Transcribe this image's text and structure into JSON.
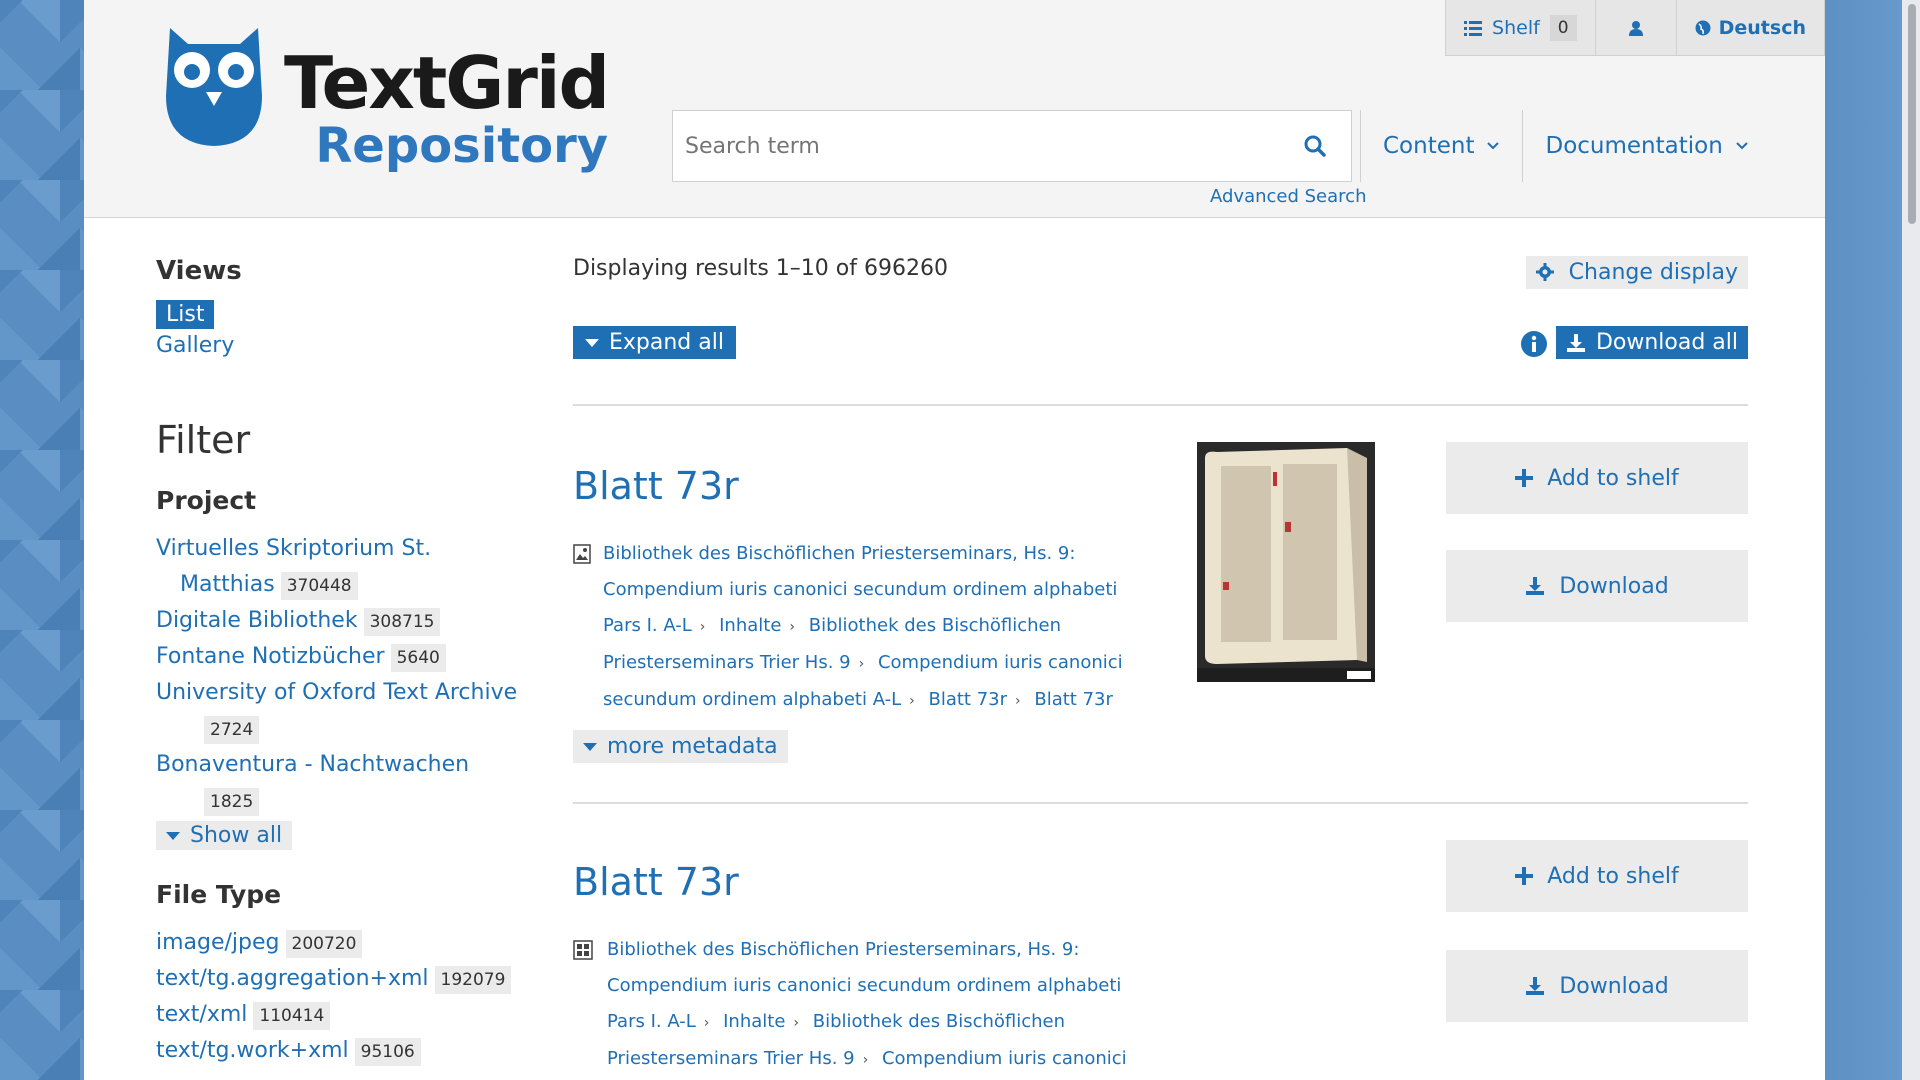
{
  "header": {
    "logo_title": "TextGrid",
    "logo_sub": "Repository",
    "shelf_label": "Shelf",
    "shelf_count": "0",
    "language": "Deutsch",
    "search_placeholder": "Search term",
    "advanced_search": "Advanced Search",
    "nav": [
      {
        "label": "Content"
      },
      {
        "label": "Documentation"
      }
    ]
  },
  "sidebar": {
    "views_title": "Views",
    "views": [
      "List",
      "Gallery"
    ],
    "filter_title": "Filter",
    "project_title": "Project",
    "projects": [
      {
        "label": "Virtuelles Skriptorium St. Matthias",
        "count": "370448"
      },
      {
        "label": "Digitale Bibliothek",
        "count": "308715"
      },
      {
        "label": "Fontane Notizbücher",
        "count": "5640"
      },
      {
        "label": "University of Oxford Text Archive",
        "count": "2724"
      },
      {
        "label": "Bonaventura - Nachtwachen",
        "count": "1825"
      }
    ],
    "show_all": "Show all",
    "filetype_title": "File Type",
    "filetypes": [
      {
        "label": "image/jpeg",
        "count": "200720"
      },
      {
        "label": "text/tg.aggregation+xml",
        "count": "192079"
      },
      {
        "label": "text/xml",
        "count": "110414"
      },
      {
        "label": "text/tg.work+xml",
        "count": "95106"
      }
    ]
  },
  "main": {
    "results_info": "Displaying results 1–10 of 696260",
    "change_display": "Change display",
    "expand_all": "Expand all",
    "download_all": "Download all",
    "add_to_shelf": "Add to shelf",
    "download": "Download",
    "more_metadata": "more metadata",
    "results": [
      {
        "title": "Blatt 73r",
        "breadcrumbs": [
          "Bibliothek des Bischöflichen Priesterseminars, Hs. 9: Compendium iuris canonici secundum ordinem alphabeti Pars I. A-L",
          "Inhalte",
          "Bibliothek des Bischöflichen Priesterseminars Trier Hs. 9",
          "Compendium iuris canonici secundum ordinem alphabeti A-L",
          "Blatt 73r",
          "Blatt 73r"
        ]
      },
      {
        "title": "Blatt 73r",
        "breadcrumbs": [
          "Bibliothek des Bischöflichen Priesterseminars, Hs. 9: Compendium iuris canonici secundum ordinem alphabeti Pars I. A-L",
          "Inhalte",
          "Bibliothek des Bischöflichen Priesterseminars Trier Hs. 9",
          "Compendium iuris canonici"
        ]
      }
    ]
  },
  "colors": {
    "accent": "#1f6fb5",
    "header_bg": "#f4f4f4",
    "button_bg": "#ebebeb"
  }
}
